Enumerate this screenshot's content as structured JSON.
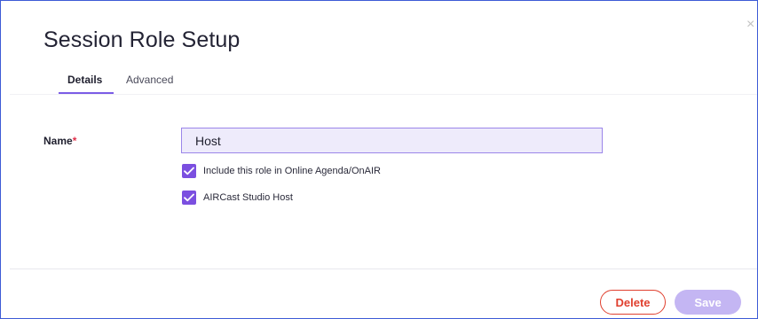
{
  "dialog": {
    "title": "Session Role Setup",
    "close_glyph": "×"
  },
  "tabs": [
    {
      "label": "Details",
      "active": true
    },
    {
      "label": "Advanced",
      "active": false
    }
  ],
  "form": {
    "name_label": "Name",
    "required_mark": "*",
    "name_value": "Host",
    "checkboxes": [
      {
        "label": "Include this role in Online Agenda/OnAIR",
        "checked": true
      },
      {
        "label": "AIRCast Studio Host",
        "checked": true
      }
    ]
  },
  "footer": {
    "delete_label": "Delete",
    "save_label": "Save"
  },
  "colors": {
    "accent": "#7b4fe0",
    "delete": "#e0402f",
    "save_disabled": "#c4b6f3"
  }
}
